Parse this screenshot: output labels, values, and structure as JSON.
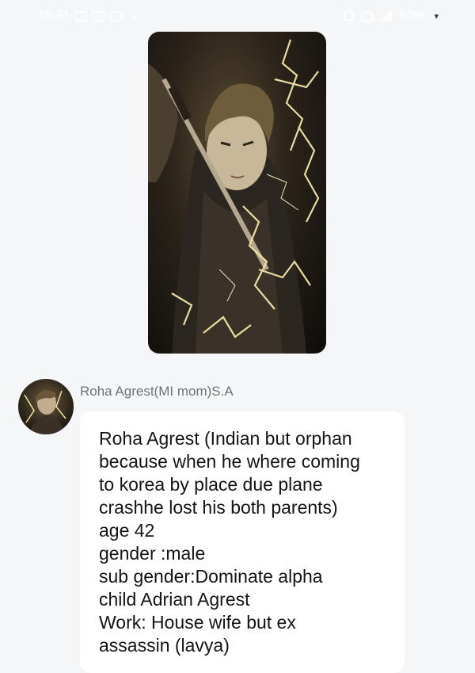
{
  "status_bar": {
    "time": "18:31",
    "left_icons": [
      "photo-icon",
      "youtube-icon",
      "instagram-icon",
      "dot-icon"
    ],
    "right_icons": [
      "alarm-icon",
      "wifi-icon",
      "lte-signal-icon"
    ],
    "battery": "63%"
  },
  "post": {
    "image_alt": "anime-character-with-lightning-icon"
  },
  "message": {
    "sender": "Roha Agrest(MI mom)S.A",
    "lines": [
      "Roha Agrest (Indian but orphan",
      "because when he where coming",
      "to korea by place due plane",
      "crashhe lost his both parents)",
      "age 42",
      "gender :male",
      "sub gender:Dominate alpha",
      "child Adrian Agrest",
      "Work: House wife but ex",
      "assassin (lavya)"
    ]
  }
}
